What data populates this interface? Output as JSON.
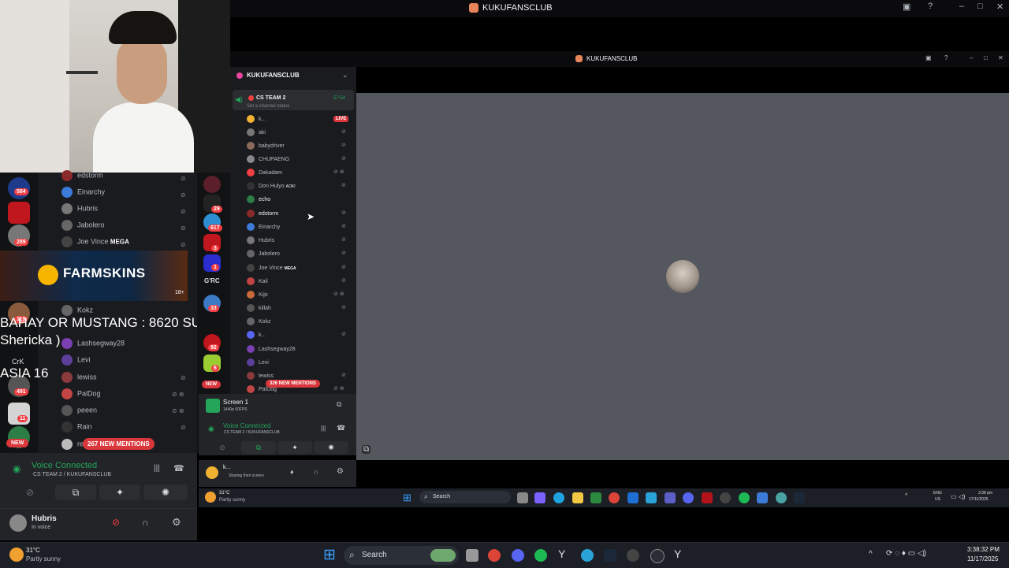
{
  "outer_window": {
    "title": "KUKUFANSCLUB"
  },
  "inner_window": {
    "title": "KUKUFANSCLUB"
  },
  "server": {
    "name": "KUKUFANSCLUB"
  },
  "voice_channel": {
    "name": "CS TEAM 2",
    "time": "57:54",
    "status_placeholder": "Set a channel status",
    "live_badge": "LIVE"
  },
  "inner_members": [
    "k...",
    "aki",
    "babydriver",
    "CHUPAENG",
    "Dakadam",
    "Don Hulyo",
    "echo",
    "edstorm",
    "Einarchy",
    "Hubris",
    "Jabolero",
    "Joe Vince",
    "Kail",
    "Kijo",
    "killah",
    "Kokz",
    "k...",
    "Lashsegway28",
    "Levi",
    "lewiss",
    "PalDog"
  ],
  "inner_tags": {
    "don_hulyo": "AOKI",
    "joe_vince": "MEGA"
  },
  "inner_new_mentions": "326 NEW MENTIONS",
  "inner_new_badge": "NEW",
  "screen_share": {
    "title": "Screen 1",
    "sub": "1440p 60FPS"
  },
  "inner_voice": {
    "status": "Voice Connected",
    "channel": "CS TEAM 2 / KUKUFANSCLUB"
  },
  "inner_user": {
    "name": "k...",
    "status": "Sharing their screen"
  },
  "left_members": [
    "edstorm",
    "Einarchy",
    "Hubris",
    "Jabolero",
    "Joe Vince",
    "Kokz",
    "Lashsegway28",
    "Levi",
    "lewiss",
    "PalDog",
    "peeen",
    "Rain",
    "re"
  ],
  "left_tags": {
    "joe_vince": "MEGA"
  },
  "left_new_mentions": "267 NEW MENTIONS",
  "left_new_badge": "NEW",
  "guild_badges": [
    "584",
    "289",
    "119",
    "491",
    "11"
  ],
  "strip_badges": [
    "29",
    "617",
    "3",
    "1",
    "33",
    "92",
    "6"
  ],
  "strip_label_grc": "G'RC",
  "left_crk": "CrK",
  "farmskins": {
    "brand": "FARMSKINS",
    "age": "18+"
  },
  "overlay": {
    "line1": "BAHAY OR MUSTANG : 8620 SUBS",
    "line2": "Shericka )",
    "line3": "ASIA 16"
  },
  "left_voice": {
    "status": "Voice Connected",
    "channel": "CS TEAM 2 / KUKUFANSCLUB"
  },
  "left_user": {
    "name": "Hubris",
    "status": "In voice"
  },
  "inner_taskbar": {
    "temp": "31°C",
    "weather": "Partly sunny",
    "search": "Search",
    "lang1": "ENG",
    "lang2": "US",
    "time": "3:38 pm",
    "date": "17/11/2025"
  },
  "main_taskbar": {
    "temp": "31°C",
    "weather": "Partly sunny",
    "search": "Search",
    "time": "3:38:32 PM",
    "date": "11/17/2025"
  },
  "colors": {
    "accent_green": "#23a55a",
    "mention_red": "#da373c",
    "blurple": "#5865f2"
  }
}
